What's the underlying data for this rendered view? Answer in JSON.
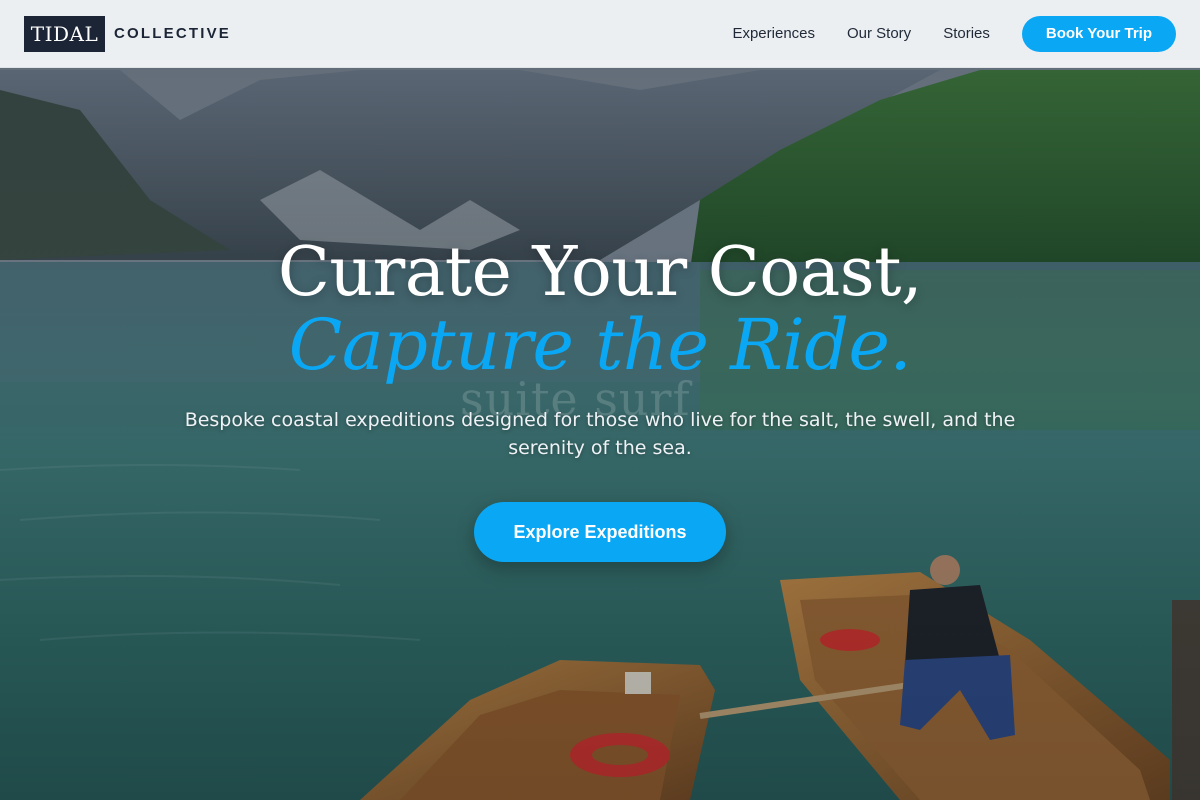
{
  "brand": {
    "logo_box": "TIDAL",
    "logo_text": "COLLECTIVE"
  },
  "nav": {
    "links": [
      "Experiences",
      "Our Story",
      "Stories"
    ],
    "cta_label": "Book Your Trip"
  },
  "hero": {
    "headline": "Curate Your Coast,",
    "headline_accent": "Capture the Ride.",
    "watermark": "suite surf",
    "subtitle": "Bespoke coastal expeditions designed for those who live for the salt, the swell, and the serenity of the sea.",
    "cta_label": "Explore Expeditions"
  },
  "colors": {
    "accent": "#0aa7f5",
    "logo_bg": "#1c2536",
    "header_bg": "#f3f5f8"
  },
  "background_image": "mountain-lake-rowboats-photo"
}
